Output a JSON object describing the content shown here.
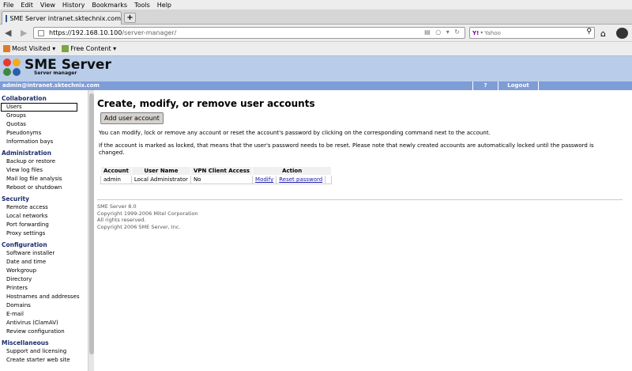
{
  "browser": {
    "menu": [
      "File",
      "Edit",
      "View",
      "History",
      "Bookmarks",
      "Tools",
      "Help"
    ],
    "tab_title": "SME Server intranet.sktechnix.com",
    "new_tab_label": "+",
    "url_host": "https://192.168.10.100",
    "url_path": "/server-manager/",
    "search_engine": "Y!",
    "search_placeholder": "Yahoo",
    "bookmarks": [
      "Most Visited ▾",
      "Free Content ▾"
    ]
  },
  "header": {
    "logo_text": "SME Server",
    "logo_sub": "Server manager",
    "user": "admin@intranet.sktechnix.com",
    "help": "?",
    "logout": "Logout"
  },
  "sidebar": {
    "sections": [
      {
        "title": "Collaboration",
        "items": [
          "Users",
          "Groups",
          "Quotas",
          "Pseudonyms",
          "Information bays"
        ]
      },
      {
        "title": "Administration",
        "items": [
          "Backup or restore",
          "View log files",
          "Mail log file analysis",
          "Reboot or shutdown"
        ]
      },
      {
        "title": "Security",
        "items": [
          "Remote access",
          "Local networks",
          "Port forwarding",
          "Proxy settings"
        ]
      },
      {
        "title": "Configuration",
        "items": [
          "Software installer",
          "Date and time",
          "Workgroup",
          "Directory",
          "Printers",
          "Hostnames and addresses",
          "Domains",
          "E-mail",
          "Antivirus (ClamAV)",
          "Review configuration"
        ]
      },
      {
        "title": "Miscellaneous",
        "items": [
          "Support and licensing",
          "Create starter web site"
        ]
      }
    ]
  },
  "main": {
    "title": "Create, modify, or remove user accounts",
    "add_button": "Add user account",
    "para1": "You can modify, lock or remove any account or reset the account's password by clicking on the corresponding command next to the account.",
    "para2": "If the account is marked as locked, that means that the user's password needs to be reset. Please note that newly created accounts are automatically locked until the password is changed.",
    "table": {
      "headers": [
        "Account",
        "User Name",
        "VPN Client Access",
        "Action"
      ],
      "row": {
        "account": "admin",
        "user_name": "Local Administrator",
        "vpn": "No",
        "modify": "Modify",
        "reset": "Reset password"
      }
    },
    "footer": [
      "SME Server 8.0",
      "Copyright 1999-2006 Mitel Corporation",
      "All rights reserved.",
      "Copyright 2006 SME Server, Inc."
    ]
  }
}
